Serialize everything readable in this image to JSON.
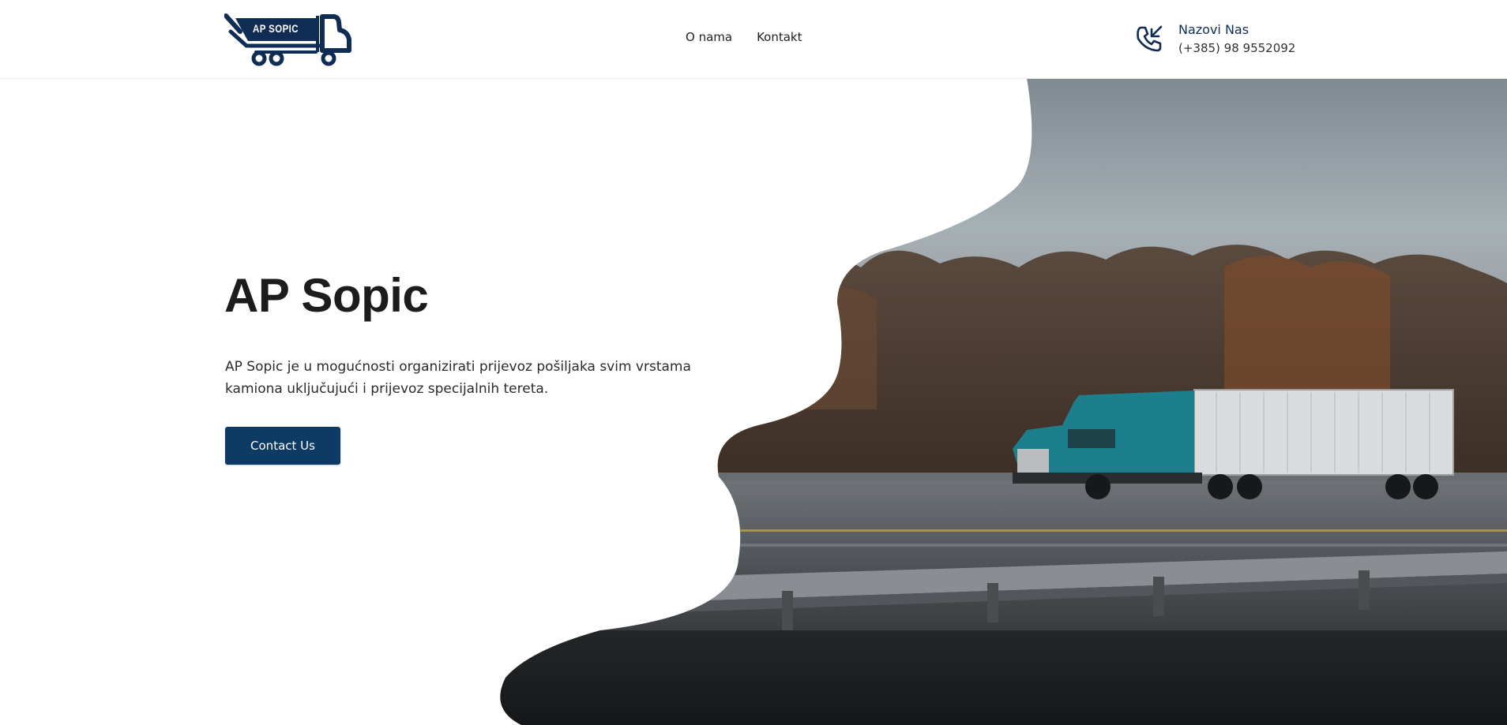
{
  "header": {
    "logo_text": "AP SOPIC",
    "nav": [
      {
        "label": "O nama"
      },
      {
        "label": "Kontakt"
      }
    ],
    "phone": {
      "title": "Nazovi Nas",
      "number": "(+385) 98 9552092",
      "icon": "phone-incoming-icon"
    }
  },
  "hero": {
    "title": "AP Sopic",
    "description": "AP Sopic je u mogućnosti organizirati prijevoz pošiljaka svim vrstama kamiona uključujući i prijevoz specijalnih tereta.",
    "cta_label": "Contact Us",
    "image_subject": "teal semi-truck on wet highway"
  },
  "colors": {
    "brand_navy": "#0f2c55",
    "button": "#0d3b66",
    "truck_cab": "#1e7f8c"
  }
}
